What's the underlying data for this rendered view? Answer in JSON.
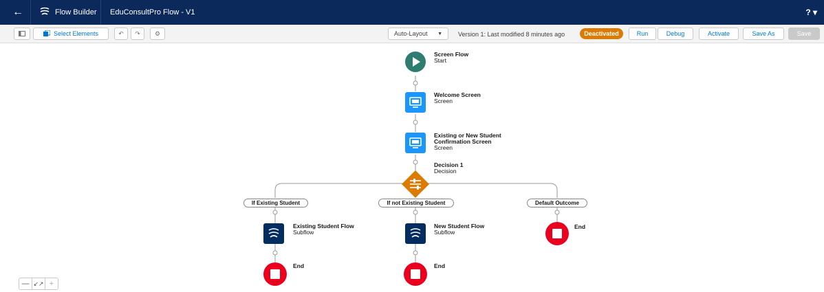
{
  "header": {
    "app_name": "Flow Builder",
    "flow_title": "EduConsultPro Flow - V1",
    "help_label": "? ▾"
  },
  "toolbar": {
    "select_elements_label": "Select Elements",
    "layout_mode": "Auto-Layout",
    "version_status": "Version 1: Last modified 8 minutes ago",
    "status_badge": "Deactivated",
    "run_label": "Run",
    "debug_label": "Debug",
    "activate_label": "Activate",
    "save_as_label": "Save As",
    "save_label": "Save"
  },
  "flow": {
    "start": {
      "title": "Screen Flow",
      "type": "Start"
    },
    "welcome": {
      "title": "Welcome Screen",
      "type": "Screen"
    },
    "confirmation": {
      "title_line1": "Existing or New Student",
      "title_line2": "Confirmation Screen",
      "type": "Screen"
    },
    "decision": {
      "title": "Decision 1",
      "type": "Decision"
    },
    "outcomes": [
      {
        "label": "If Existing Student"
      },
      {
        "label": "If not Existing Student"
      },
      {
        "label": "Default Outcome"
      }
    ],
    "subflow_existing": {
      "title": "Existing Student Flow",
      "type": "Subflow"
    },
    "subflow_new": {
      "title": "New Student Flow",
      "type": "Subflow"
    },
    "end_label": "End"
  },
  "colors": {
    "header_bg": "#0b2a5b",
    "start": "#2e7d70",
    "screen": "#1b96ff",
    "decision": "#dd7a01",
    "subflow": "#032d60",
    "end": "#ea001e",
    "badge": "#dd7a01"
  }
}
